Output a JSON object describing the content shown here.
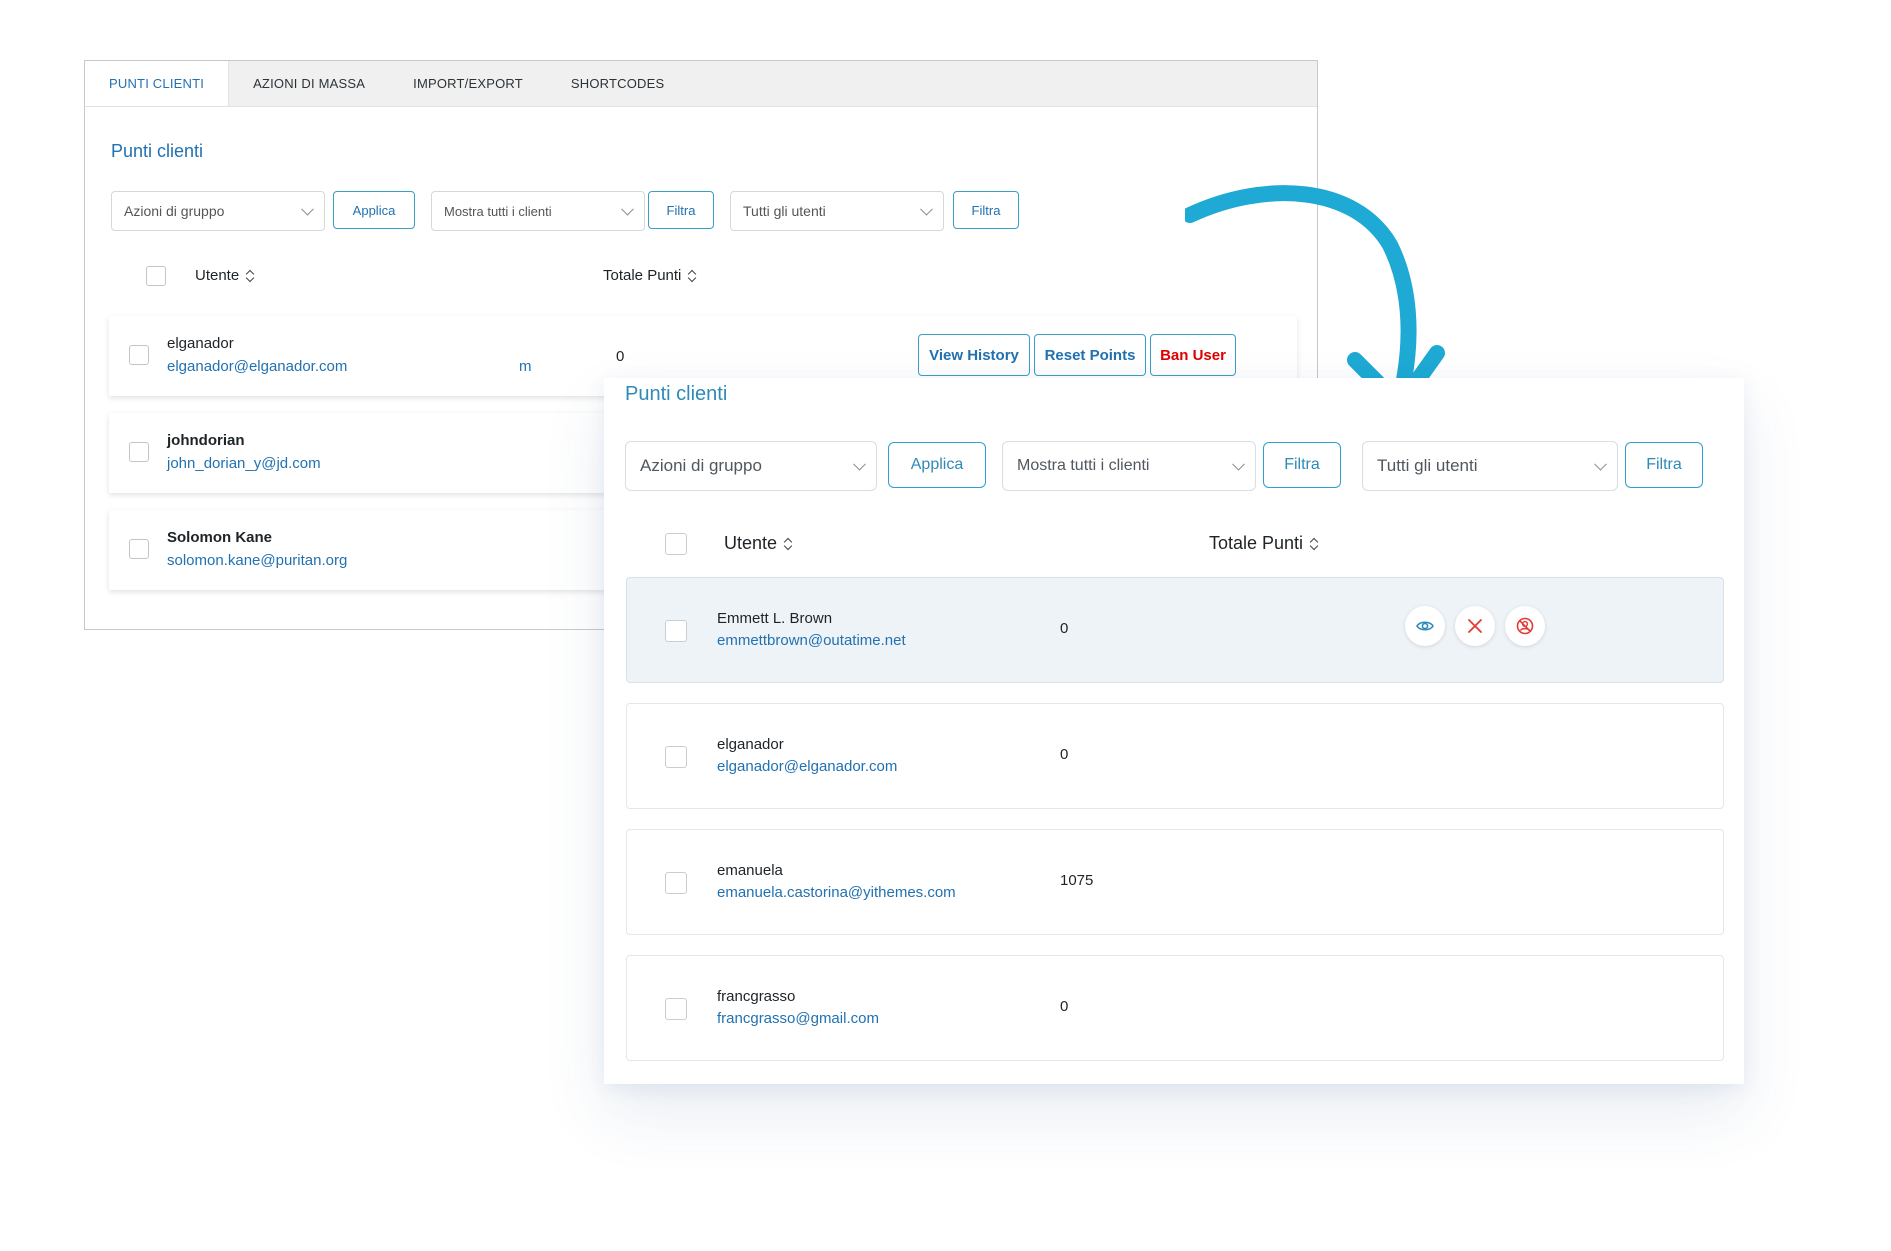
{
  "old": {
    "tabs": [
      "PUNTI CLIENTI",
      "AZIONI DI MASSA",
      "IMPORT/EXPORT",
      "SHORTCODES"
    ],
    "title": "Punti clienti",
    "bulk_select": "Azioni di gruppo",
    "apply": "Applica",
    "customers_select": "Mostra tutti i clienti",
    "filter": "Filtra",
    "users_select": "Tutti gli utenti",
    "col_user": "Utente",
    "col_points": "Totale Punti",
    "rows": [
      {
        "name": "elganador",
        "email": "elganador@elganador.com",
        "extra": "m",
        "points": "0"
      },
      {
        "name": "johndorian",
        "email": "john_dorian_y@jd.com"
      },
      {
        "name": "Solomon Kane",
        "email": "solomon.kane@puritan.org"
      }
    ],
    "actions": {
      "history": "View History",
      "reset": "Reset Points",
      "ban": "Ban User"
    }
  },
  "new": {
    "title": "Punti clienti",
    "bulk_select": "Azioni di gruppo",
    "apply": "Applica",
    "customers_select": "Mostra tutti i clienti",
    "filter": "Filtra",
    "users_select": "Tutti gli utenti",
    "col_user": "Utente",
    "col_points": "Totale Punti",
    "rows": [
      {
        "name": "Emmett L. Brown",
        "email": "emmettbrown@outatime.net",
        "points": "0"
      },
      {
        "name": "elganador",
        "email": "elganador@elganador.com",
        "points": "0"
      },
      {
        "name": "emanuela",
        "email": "emanuela.castorina@yithemes.com",
        "points": "1075"
      },
      {
        "name": "francgrasso",
        "email": "francgrasso@gmail.com",
        "points": "0"
      }
    ],
    "row_icons": [
      "eye-icon",
      "close-icon",
      "ban-icon"
    ]
  },
  "colors": {
    "accent": "#2e9fcf",
    "link": "#2271b1",
    "danger": "#e00000",
    "arrow": "#1eaad4"
  }
}
